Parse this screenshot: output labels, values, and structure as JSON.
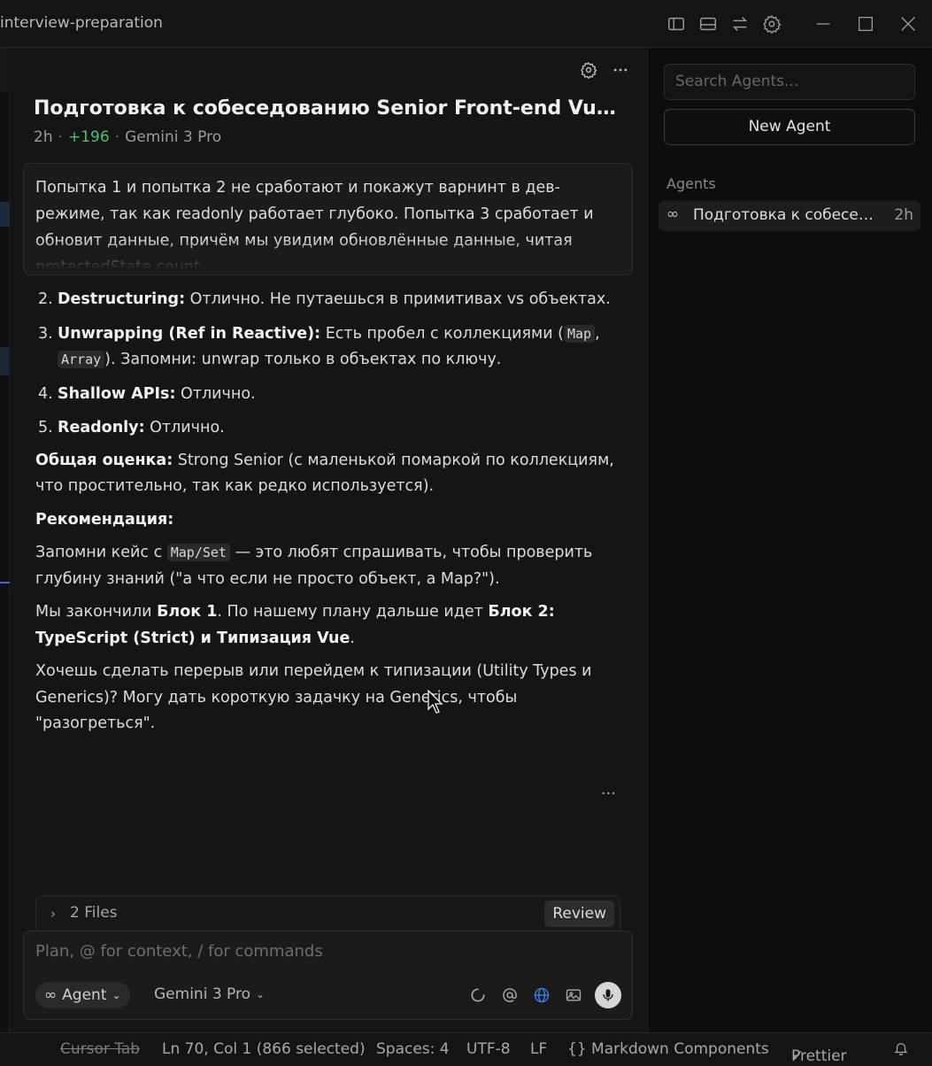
{
  "window": {
    "title": "interview-preparation"
  },
  "chat": {
    "title": "Подготовка к собеседованию Senior Front-end Vue...",
    "meta_time": "2h",
    "meta_diff": "+196",
    "meta_model": "Gemini 3 Pro",
    "user_message": "Попытка 1 и попытка 2 не сработают и покажут варнинт в дев-режиме, так как readonly работает глубоко. Попытка 3 сработает и обновит данные, причём мы увидим обновлённые данные, читая protectedState.count",
    "list": [
      {
        "num": "2.",
        "label": "Destructuring:",
        "text": " Отлично. Не путаешься в примитивах vs объектах."
      },
      {
        "num": "3.",
        "label": "Unwrapping (Ref in Reactive):",
        "text_before": " Есть пробел с коллекциями (",
        "code1": "Map",
        "sep": ", ",
        "code2": "Array",
        "text_after": "). Запомни: unwrap только в объектах по ключу."
      },
      {
        "num": "4.",
        "label": "Shallow APIs:",
        "text": " Отлично."
      },
      {
        "num": "5.",
        "label": "Readonly:",
        "text": " Отлично."
      }
    ],
    "overall_label": "Общая оценка:",
    "overall_text": " Strong Senior (с маленькой помаркой по коллекциям, что простительно, так как редко используется).",
    "rec_label": "Рекомендация:",
    "rec_before": "Запомни кейс с ",
    "rec_code": "Map/Set",
    "rec_after": " — это любят спрашивать, чтобы проверить глубину знаний (\"а что если не просто объект, а Map?\").",
    "finished_before": "Мы закончили ",
    "finished_block1": "Блок 1",
    "finished_mid": ". По нашему плану дальше идет ",
    "finished_block2": "Блок 2: TypeScript (Strict) и Типизация Vue",
    "finished_end": ".",
    "question": "Хочешь сделать перерыв или перейдем к типизации (Utility Types и Generics)? Могу дать короткую задачку на Generics, чтобы \"разогреться\"."
  },
  "files": {
    "label": "2 Files",
    "review": "Review"
  },
  "composer": {
    "placeholder": "Plan, @ for context, / for commands",
    "agent_label": "Agent",
    "model_label": "Gemini 3 Pro"
  },
  "sidebar": {
    "search_placeholder": "Search Agents...",
    "new_agent": "New Agent",
    "section_label": "Agents",
    "agents": [
      {
        "name": "Подготовка к собеседованию Senior Front-end Vue",
        "time": "2h"
      }
    ]
  },
  "status": {
    "cursor_tab": "Cursor Tab",
    "position": "Ln 70, Col 1 (866 selected)",
    "spaces": "Spaces: 4",
    "encoding": "UTF-8",
    "eol": "LF",
    "language": "{} Markdown Components",
    "prettier": "Prettier"
  },
  "colors": {
    "accent_green": "#4fbf6a",
    "globe_blue": "#3b82f6"
  }
}
